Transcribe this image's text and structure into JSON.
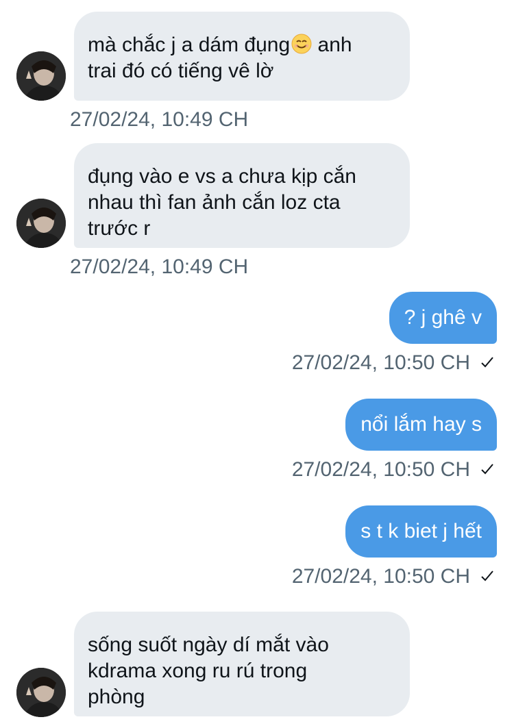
{
  "conversation": {
    "messages": [
      {
        "direction": "incoming",
        "text": "mà chắc j a dám đụng",
        "emoji": "smiling-face",
        "text_after_emoji": " anh\ntrai đó có tiếng vê lờ",
        "timestamp": "27/02/24, 10:49 CH"
      },
      {
        "direction": "incoming",
        "text": "đụng vào e vs a chưa kịp cắn\nnhau thì fan ảnh cắn loz cta\ntrước r",
        "timestamp": "27/02/24, 10:49 CH"
      },
      {
        "direction": "outgoing",
        "text": "? j ghê v",
        "timestamp": "27/02/24, 10:50 CH",
        "status": "sent-check"
      },
      {
        "direction": "outgoing",
        "text": "nổi lắm hay s",
        "timestamp": "27/02/24, 10:50 CH",
        "status": "sent-check"
      },
      {
        "direction": "outgoing",
        "text": "s t k biet j hết",
        "timestamp": "27/02/24, 10:50 CH",
        "status": "sent-check"
      },
      {
        "direction": "incoming",
        "text": "sống suốt ngày dí mắt vào\nkdrama xong ru rú trong\nphòng",
        "timestamp": ""
      }
    ]
  },
  "colors": {
    "incoming_bubble": "#e8ecf0",
    "outgoing_bubble": "#4a9ae6",
    "timestamp": "#536471",
    "text": "#0f1419"
  },
  "icons": {
    "emoji": "smiling-face-emoji",
    "status": "check-icon",
    "avatar": "avatar-photo"
  }
}
